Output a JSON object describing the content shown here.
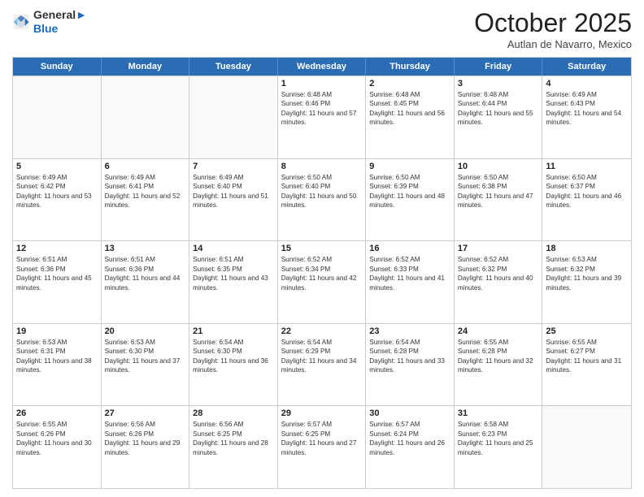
{
  "header": {
    "logo_general": "General",
    "logo_blue": "Blue",
    "month": "October 2025",
    "location": "Autlan de Navarro, Mexico"
  },
  "weekdays": [
    "Sunday",
    "Monday",
    "Tuesday",
    "Wednesday",
    "Thursday",
    "Friday",
    "Saturday"
  ],
  "rows": [
    [
      {
        "day": "",
        "info": ""
      },
      {
        "day": "",
        "info": ""
      },
      {
        "day": "",
        "info": ""
      },
      {
        "day": "1",
        "info": "Sunrise: 6:48 AM\nSunset: 6:46 PM\nDaylight: 11 hours and 57 minutes."
      },
      {
        "day": "2",
        "info": "Sunrise: 6:48 AM\nSunset: 6:45 PM\nDaylight: 11 hours and 56 minutes."
      },
      {
        "day": "3",
        "info": "Sunrise: 6:48 AM\nSunset: 6:44 PM\nDaylight: 11 hours and 55 minutes."
      },
      {
        "day": "4",
        "info": "Sunrise: 6:49 AM\nSunset: 6:43 PM\nDaylight: 11 hours and 54 minutes."
      }
    ],
    [
      {
        "day": "5",
        "info": "Sunrise: 6:49 AM\nSunset: 6:42 PM\nDaylight: 11 hours and 53 minutes."
      },
      {
        "day": "6",
        "info": "Sunrise: 6:49 AM\nSunset: 6:41 PM\nDaylight: 11 hours and 52 minutes."
      },
      {
        "day": "7",
        "info": "Sunrise: 6:49 AM\nSunset: 6:40 PM\nDaylight: 11 hours and 51 minutes."
      },
      {
        "day": "8",
        "info": "Sunrise: 6:50 AM\nSunset: 6:40 PM\nDaylight: 11 hours and 50 minutes."
      },
      {
        "day": "9",
        "info": "Sunrise: 6:50 AM\nSunset: 6:39 PM\nDaylight: 11 hours and 48 minutes."
      },
      {
        "day": "10",
        "info": "Sunrise: 6:50 AM\nSunset: 6:38 PM\nDaylight: 11 hours and 47 minutes."
      },
      {
        "day": "11",
        "info": "Sunrise: 6:50 AM\nSunset: 6:37 PM\nDaylight: 11 hours and 46 minutes."
      }
    ],
    [
      {
        "day": "12",
        "info": "Sunrise: 6:51 AM\nSunset: 6:36 PM\nDaylight: 11 hours and 45 minutes."
      },
      {
        "day": "13",
        "info": "Sunrise: 6:51 AM\nSunset: 6:36 PM\nDaylight: 11 hours and 44 minutes."
      },
      {
        "day": "14",
        "info": "Sunrise: 6:51 AM\nSunset: 6:35 PM\nDaylight: 11 hours and 43 minutes."
      },
      {
        "day": "15",
        "info": "Sunrise: 6:52 AM\nSunset: 6:34 PM\nDaylight: 11 hours and 42 minutes."
      },
      {
        "day": "16",
        "info": "Sunrise: 6:52 AM\nSunset: 6:33 PM\nDaylight: 11 hours and 41 minutes."
      },
      {
        "day": "17",
        "info": "Sunrise: 6:52 AM\nSunset: 6:32 PM\nDaylight: 11 hours and 40 minutes."
      },
      {
        "day": "18",
        "info": "Sunrise: 6:53 AM\nSunset: 6:32 PM\nDaylight: 11 hours and 39 minutes."
      }
    ],
    [
      {
        "day": "19",
        "info": "Sunrise: 6:53 AM\nSunset: 6:31 PM\nDaylight: 11 hours and 38 minutes."
      },
      {
        "day": "20",
        "info": "Sunrise: 6:53 AM\nSunset: 6:30 PM\nDaylight: 11 hours and 37 minutes."
      },
      {
        "day": "21",
        "info": "Sunrise: 6:54 AM\nSunset: 6:30 PM\nDaylight: 11 hours and 36 minutes."
      },
      {
        "day": "22",
        "info": "Sunrise: 6:54 AM\nSunset: 6:29 PM\nDaylight: 11 hours and 34 minutes."
      },
      {
        "day": "23",
        "info": "Sunrise: 6:54 AM\nSunset: 6:28 PM\nDaylight: 11 hours and 33 minutes."
      },
      {
        "day": "24",
        "info": "Sunrise: 6:55 AM\nSunset: 6:28 PM\nDaylight: 11 hours and 32 minutes."
      },
      {
        "day": "25",
        "info": "Sunrise: 6:55 AM\nSunset: 6:27 PM\nDaylight: 11 hours and 31 minutes."
      }
    ],
    [
      {
        "day": "26",
        "info": "Sunrise: 6:55 AM\nSunset: 6:26 PM\nDaylight: 11 hours and 30 minutes."
      },
      {
        "day": "27",
        "info": "Sunrise: 6:56 AM\nSunset: 6:26 PM\nDaylight: 11 hours and 29 minutes."
      },
      {
        "day": "28",
        "info": "Sunrise: 6:56 AM\nSunset: 6:25 PM\nDaylight: 11 hours and 28 minutes."
      },
      {
        "day": "29",
        "info": "Sunrise: 6:57 AM\nSunset: 6:25 PM\nDaylight: 11 hours and 27 minutes."
      },
      {
        "day": "30",
        "info": "Sunrise: 6:57 AM\nSunset: 6:24 PM\nDaylight: 11 hours and 26 minutes."
      },
      {
        "day": "31",
        "info": "Sunrise: 6:58 AM\nSunset: 6:23 PM\nDaylight: 11 hours and 25 minutes."
      },
      {
        "day": "",
        "info": ""
      }
    ]
  ]
}
